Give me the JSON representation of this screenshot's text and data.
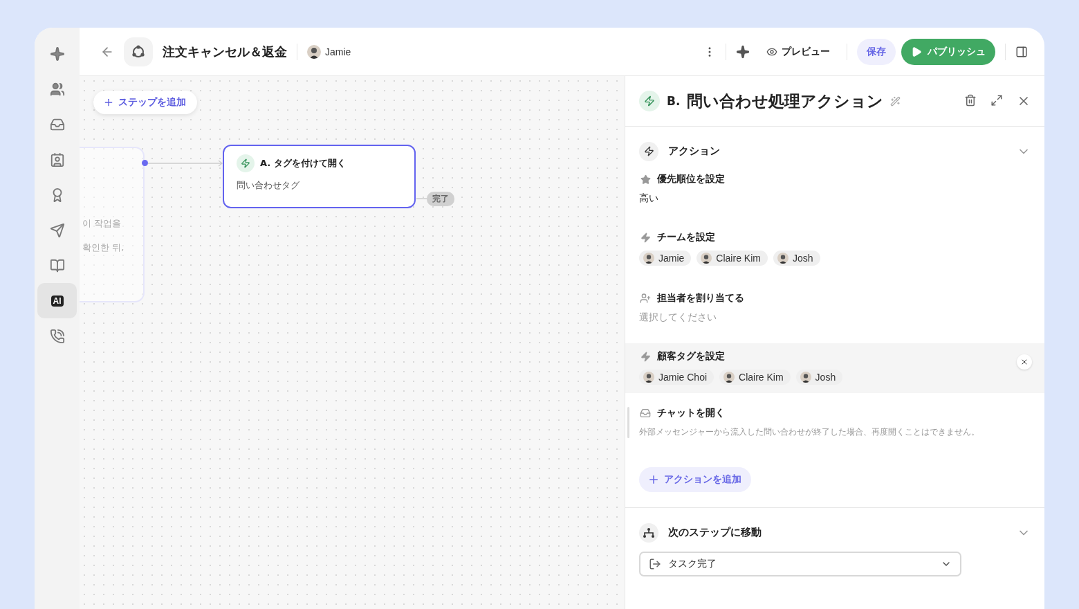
{
  "sidebar": {
    "items": [
      {
        "kind": "sparkle",
        "selected": false
      },
      {
        "kind": "people",
        "selected": false
      },
      {
        "kind": "inbox",
        "selected": false
      },
      {
        "kind": "contact",
        "selected": false
      },
      {
        "kind": "badge",
        "selected": false
      },
      {
        "kind": "send",
        "selected": false
      },
      {
        "kind": "book",
        "selected": false
      },
      {
        "kind": "ai",
        "label": "AI",
        "selected": true
      },
      {
        "kind": "phone",
        "selected": false
      }
    ]
  },
  "header": {
    "title": "注文キャンセル＆返金",
    "owner": "Jamie",
    "preview": "プレビュー",
    "save": "保存",
    "publish": "パブリッシュ"
  },
  "canvas": {
    "add_step": "ステップを追加",
    "previous_node": {
      "lines": [
        "이 작업을",
        "확인한 뒤,"
      ]
    },
    "node": {
      "title": "A. タグを付けて開く",
      "subtitle": "問い合わせタグ",
      "selected": true
    },
    "end_label": "完了"
  },
  "panel": {
    "badge": "B.",
    "title": "問い合わせ処理アクション",
    "actions": {
      "title": "アクション",
      "expanded": true,
      "items": [
        {
          "kind": "priority",
          "title": "優先順位を設定",
          "value": "高い",
          "selected": false
        },
        {
          "kind": "team",
          "title": "チームを設定",
          "chips": [
            "Jamie",
            "Claire Kim",
            "Josh"
          ],
          "selected": false
        },
        {
          "kind": "assignee",
          "title": "担当者を割り当てる",
          "placeholder": "選択してください",
          "selected": false
        },
        {
          "kind": "tags",
          "title": "顧客タグを設定",
          "chips": [
            "Jamie Choi",
            "Claire Kim",
            "Josh"
          ],
          "selected": true
        },
        {
          "kind": "chat",
          "title": "チャットを開く",
          "description": "外部メッセンジャーから流入した問い合わせが終了した場合、再度開くことはできません。",
          "selected": false
        }
      ],
      "add_action": "アクションを追加"
    },
    "next": {
      "title": "次のステップに移動",
      "expanded": true,
      "value": "タスク完了"
    }
  }
}
